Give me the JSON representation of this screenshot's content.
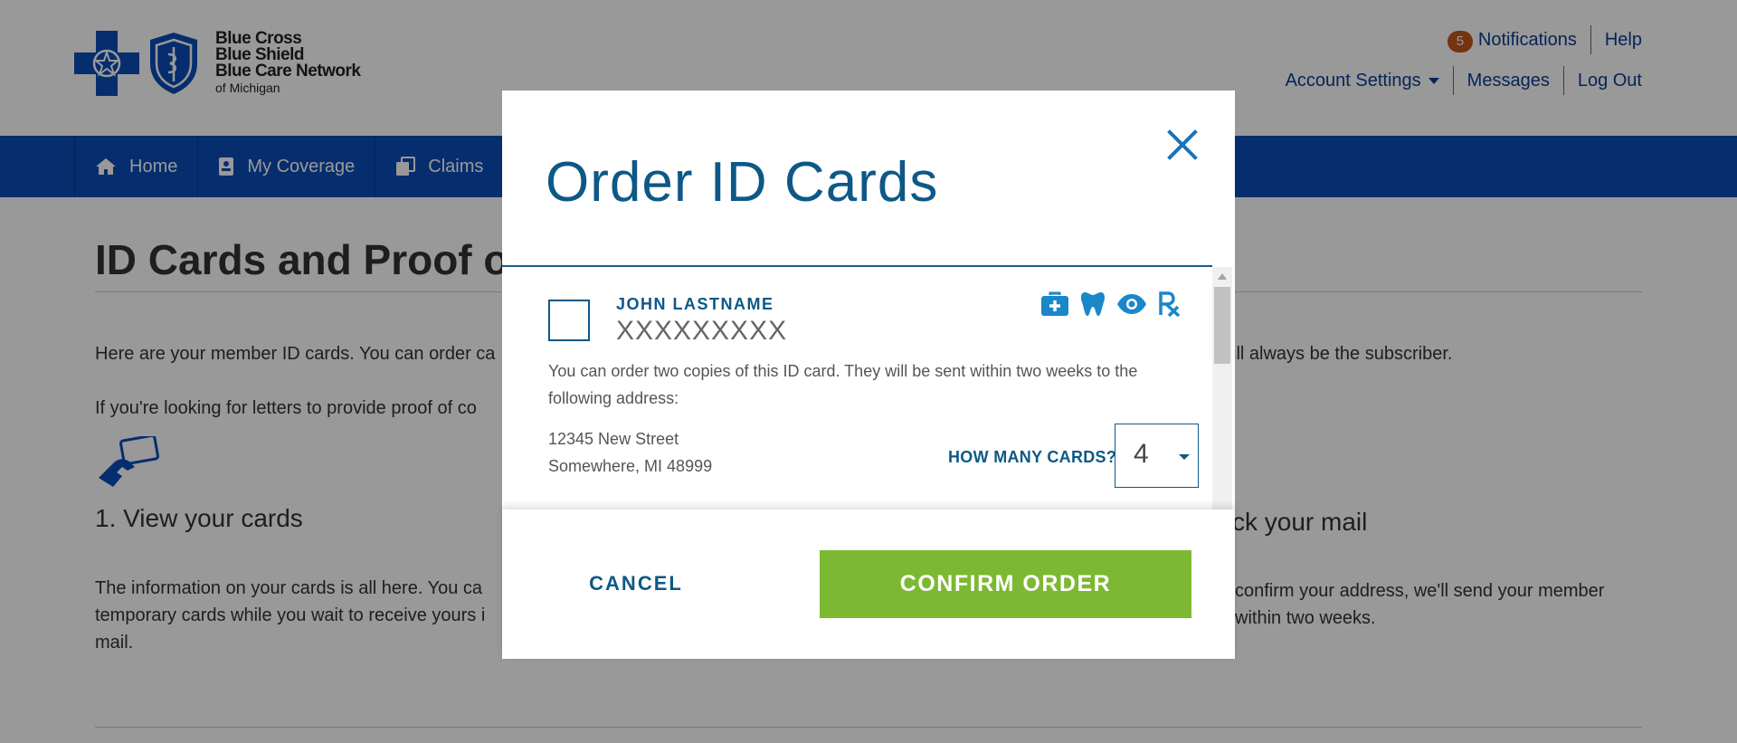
{
  "header": {
    "logo": {
      "line1": "Blue Cross",
      "line2": "Blue Shield",
      "line3": "Blue Care Network",
      "line4": "of Michigan"
    },
    "notifications": {
      "count": "5",
      "label": "Notifications"
    },
    "help": "Help",
    "account_settings": "Account Settings",
    "messages": "Messages",
    "logout": "Log Out"
  },
  "nav": {
    "items": [
      {
        "label": "Home",
        "icon": "home-icon"
      },
      {
        "label": "My Coverage",
        "icon": "id-badge-icon"
      },
      {
        "label": "Claims",
        "icon": "copy-icon"
      }
    ]
  },
  "page": {
    "title": "ID Cards and Proof of",
    "intro": "Here are your member ID cards. You can order ca",
    "intro_end": "ill always be the subscriber.",
    "proof_text": "If you're looking for letters to provide proof of co",
    "section1": {
      "heading": "1. View your cards",
      "line1": "The information on your cards is all here. You ca",
      "line2": "temporary cards while you wait to receive yours i",
      "line3": "mail."
    },
    "section3": {
      "heading": "ck your mail",
      "line1": "confirm your address, we'll send your member",
      "line2": "within two weeks."
    }
  },
  "modal": {
    "title": "Order ID Cards",
    "member_name": "JOHN LASTNAME",
    "member_id": "XXXXXXXXX",
    "coverage_icons": [
      "medical-bag-icon",
      "tooth-icon",
      "eye-icon",
      "rx-icon"
    ],
    "description": "You can order two copies of this ID card. They will be sent within two weeks to the following address:",
    "address_line1": "12345 New Street",
    "address_line2": "Somewhere, MI 48999",
    "how_many_label": "HOW MANY CARDS?",
    "quantity": "4",
    "cancel_label": "CANCEL",
    "confirm_label": "CONFIRM ORDER"
  },
  "colors": {
    "brand_blue": "#0b4bb8",
    "modal_blue": "#0d5886",
    "confirm_green": "#7db833",
    "badge_orange": "#c4581b",
    "icon_blue": "#1a87c8"
  }
}
